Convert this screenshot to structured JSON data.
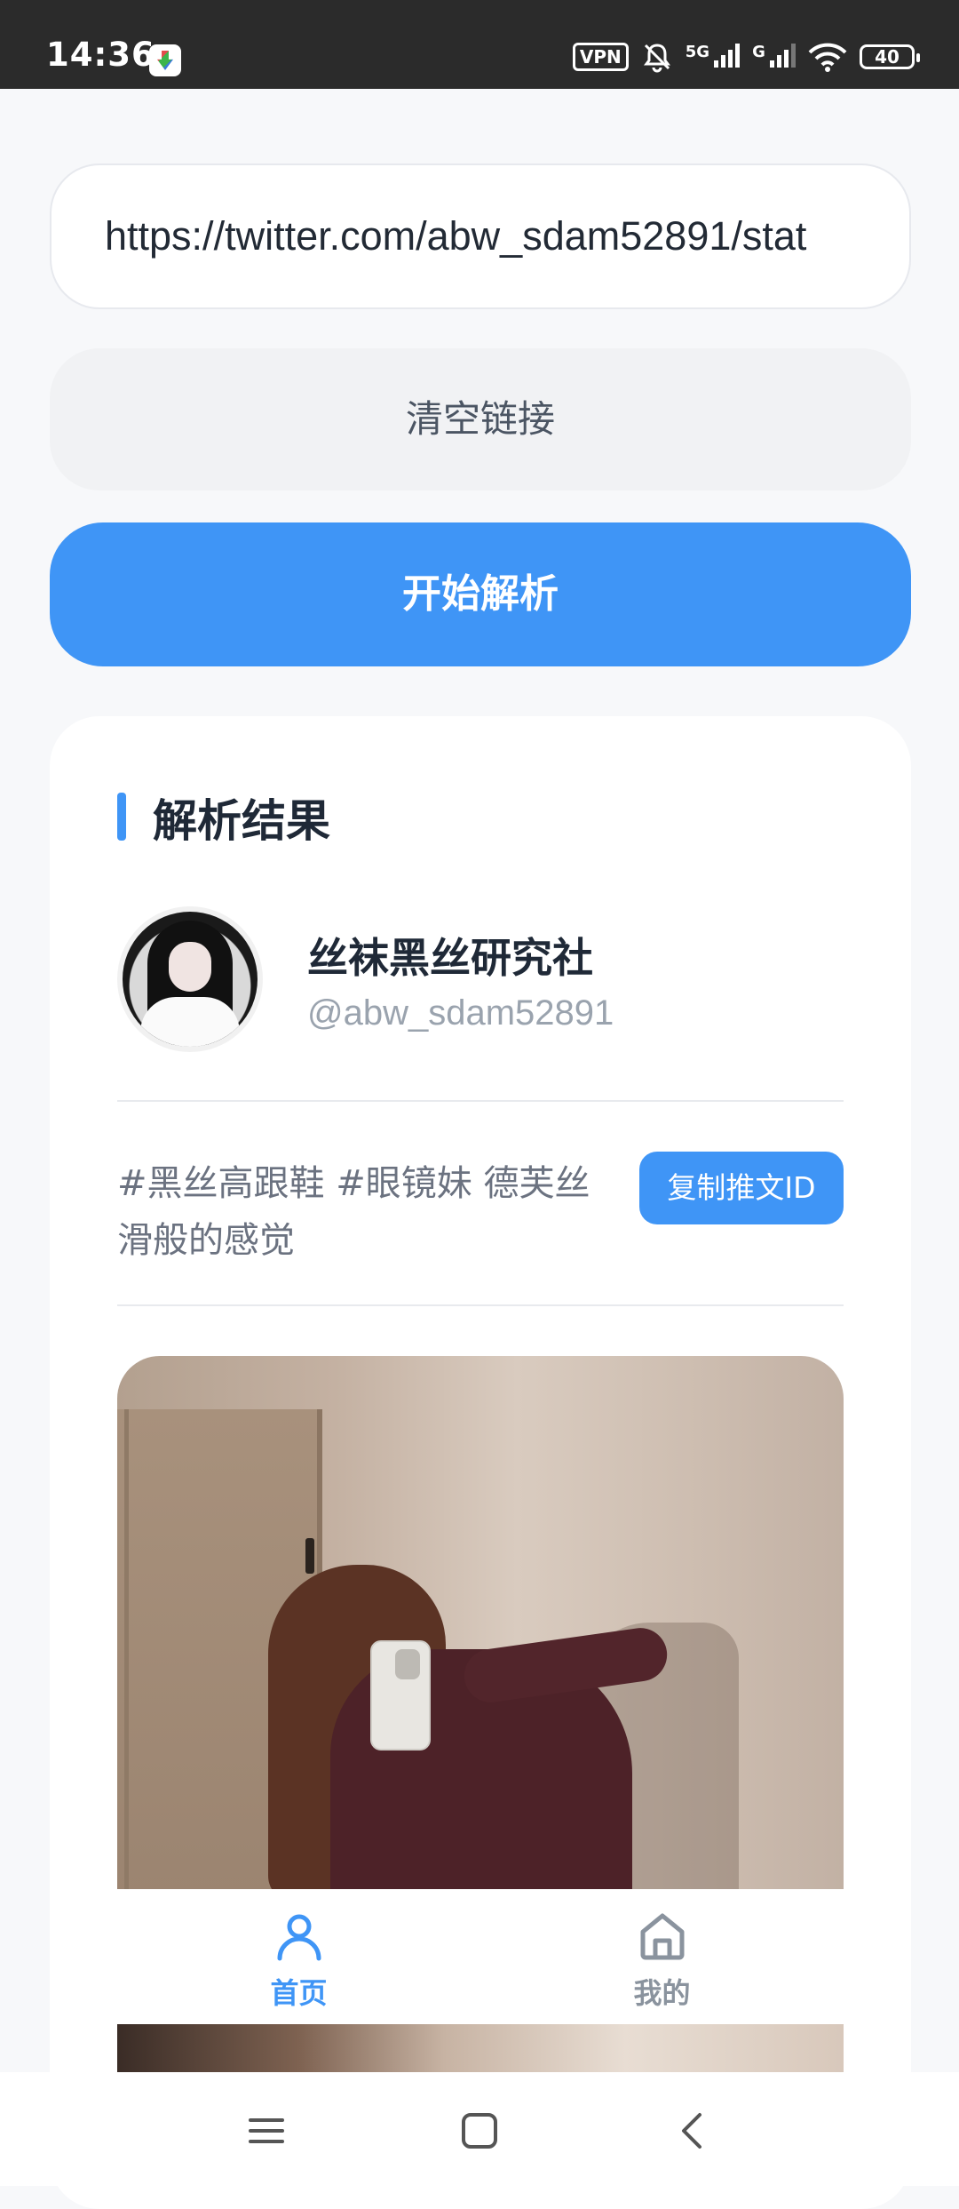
{
  "status_bar": {
    "time": "14:36",
    "vpn": "VPN",
    "net_1": "5G",
    "net_2": "G",
    "battery": "40"
  },
  "url_input": {
    "value": "https://twitter.com/abw_sdam52891/stat"
  },
  "buttons": {
    "clear_label": "清空链接",
    "parse_label": "开始解析",
    "copy_label": "复制推文ID"
  },
  "result": {
    "title": "解析结果",
    "user_name": "丝袜黑丝研究社",
    "user_handle": "@abw_sdam52891",
    "tweet_text": "#黑丝高跟鞋 #眼镜妹 德芙丝滑般的感觉"
  },
  "tabs": [
    {
      "label": "首页",
      "icon": "user-icon",
      "active": true
    },
    {
      "label": "我的",
      "icon": "home-icon",
      "active": false
    }
  ],
  "colors": {
    "accent": "#3f95f6",
    "background": "#f7f8fa",
    "status_bar": "#2b2b2b"
  },
  "nav": [
    "menu-icon",
    "home-square-icon",
    "back-icon"
  ]
}
